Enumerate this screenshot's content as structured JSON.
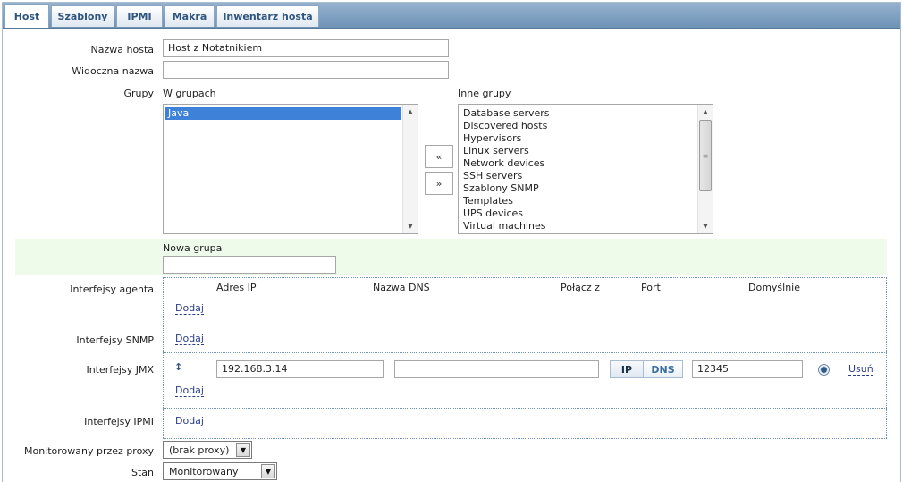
{
  "tabs": [
    {
      "label": "Host",
      "active": true
    },
    {
      "label": "Szablony",
      "active": false
    },
    {
      "label": "IPMI",
      "active": false
    },
    {
      "label": "Makra",
      "active": false
    },
    {
      "label": "Inwentarz hosta",
      "active": false
    }
  ],
  "form": {
    "host_name": {
      "label": "Nazwa hosta",
      "value": "Host z Notatnikiem"
    },
    "visible_name": {
      "label": "Widoczna nazwa",
      "value": ""
    },
    "groups": {
      "label": "Grupy",
      "in_groups_label": "W grupach",
      "in_groups": [
        "Java"
      ],
      "other_groups_label": "Inne grupy",
      "other_groups": [
        "Database servers",
        "Discovered hosts",
        "Hypervisors",
        "Linux servers",
        "Network devices",
        "SSH servers",
        "Szablony SNMP",
        "Templates",
        "UPS devices",
        "Virtual machines"
      ],
      "move_left": "«",
      "move_right": "»"
    },
    "new_group": {
      "label": "Nowa grupa",
      "value": ""
    },
    "interfaces": {
      "agent_label": "Interfejsy agenta",
      "snmp_label": "Interfejsy SNMP",
      "jmx_label": "Interfejsy JMX",
      "ipmi_label": "Interfejsy IPMI",
      "columns": {
        "ip": "Adres IP",
        "dns": "Nazwa DNS",
        "connect": "Połącz z",
        "port": "Port",
        "default": "Domyślnie"
      },
      "add_label": "Dodaj",
      "jmx_row": {
        "ip": "192.168.3.14",
        "dns": "",
        "connect_ip": "IP",
        "connect_dns": "DNS",
        "port": "12345",
        "remove": "Usuń",
        "drag_icon": "updown-arrows-icon",
        "default_selected": true
      }
    },
    "proxy": {
      "label": "Monitorowany przez proxy",
      "value": "(brak proxy)"
    },
    "status": {
      "label": "Stan",
      "value": "Monitorowany"
    }
  },
  "colors": {
    "tabbar": "#7f9fc1",
    "tab_text": "#2e5580",
    "link": "#2c3e8d",
    "new_group_bg": "#eefbeb",
    "selected_item": "#3d82d8"
  }
}
